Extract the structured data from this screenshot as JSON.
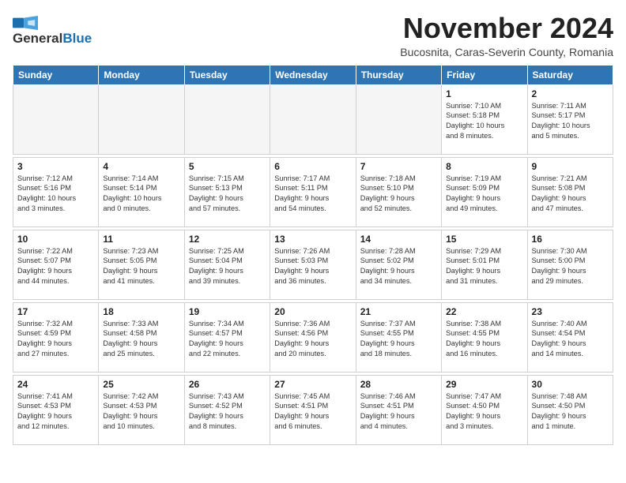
{
  "header": {
    "logo_line1": "General",
    "logo_line2": "Blue",
    "month_title": "November 2024",
    "subtitle": "Bucosnita, Caras-Severin County, Romania"
  },
  "weekdays": [
    "Sunday",
    "Monday",
    "Tuesday",
    "Wednesday",
    "Thursday",
    "Friday",
    "Saturday"
  ],
  "weeks": [
    [
      {
        "day": "",
        "info": ""
      },
      {
        "day": "",
        "info": ""
      },
      {
        "day": "",
        "info": ""
      },
      {
        "day": "",
        "info": ""
      },
      {
        "day": "",
        "info": ""
      },
      {
        "day": "1",
        "info": "Sunrise: 7:10 AM\nSunset: 5:18 PM\nDaylight: 10 hours\nand 8 minutes."
      },
      {
        "day": "2",
        "info": "Sunrise: 7:11 AM\nSunset: 5:17 PM\nDaylight: 10 hours\nand 5 minutes."
      }
    ],
    [
      {
        "day": "3",
        "info": "Sunrise: 7:12 AM\nSunset: 5:16 PM\nDaylight: 10 hours\nand 3 minutes."
      },
      {
        "day": "4",
        "info": "Sunrise: 7:14 AM\nSunset: 5:14 PM\nDaylight: 10 hours\nand 0 minutes."
      },
      {
        "day": "5",
        "info": "Sunrise: 7:15 AM\nSunset: 5:13 PM\nDaylight: 9 hours\nand 57 minutes."
      },
      {
        "day": "6",
        "info": "Sunrise: 7:17 AM\nSunset: 5:11 PM\nDaylight: 9 hours\nand 54 minutes."
      },
      {
        "day": "7",
        "info": "Sunrise: 7:18 AM\nSunset: 5:10 PM\nDaylight: 9 hours\nand 52 minutes."
      },
      {
        "day": "8",
        "info": "Sunrise: 7:19 AM\nSunset: 5:09 PM\nDaylight: 9 hours\nand 49 minutes."
      },
      {
        "day": "9",
        "info": "Sunrise: 7:21 AM\nSunset: 5:08 PM\nDaylight: 9 hours\nand 47 minutes."
      }
    ],
    [
      {
        "day": "10",
        "info": "Sunrise: 7:22 AM\nSunset: 5:07 PM\nDaylight: 9 hours\nand 44 minutes."
      },
      {
        "day": "11",
        "info": "Sunrise: 7:23 AM\nSunset: 5:05 PM\nDaylight: 9 hours\nand 41 minutes."
      },
      {
        "day": "12",
        "info": "Sunrise: 7:25 AM\nSunset: 5:04 PM\nDaylight: 9 hours\nand 39 minutes."
      },
      {
        "day": "13",
        "info": "Sunrise: 7:26 AM\nSunset: 5:03 PM\nDaylight: 9 hours\nand 36 minutes."
      },
      {
        "day": "14",
        "info": "Sunrise: 7:28 AM\nSunset: 5:02 PM\nDaylight: 9 hours\nand 34 minutes."
      },
      {
        "day": "15",
        "info": "Sunrise: 7:29 AM\nSunset: 5:01 PM\nDaylight: 9 hours\nand 31 minutes."
      },
      {
        "day": "16",
        "info": "Sunrise: 7:30 AM\nSunset: 5:00 PM\nDaylight: 9 hours\nand 29 minutes."
      }
    ],
    [
      {
        "day": "17",
        "info": "Sunrise: 7:32 AM\nSunset: 4:59 PM\nDaylight: 9 hours\nand 27 minutes."
      },
      {
        "day": "18",
        "info": "Sunrise: 7:33 AM\nSunset: 4:58 PM\nDaylight: 9 hours\nand 25 minutes."
      },
      {
        "day": "19",
        "info": "Sunrise: 7:34 AM\nSunset: 4:57 PM\nDaylight: 9 hours\nand 22 minutes."
      },
      {
        "day": "20",
        "info": "Sunrise: 7:36 AM\nSunset: 4:56 PM\nDaylight: 9 hours\nand 20 minutes."
      },
      {
        "day": "21",
        "info": "Sunrise: 7:37 AM\nSunset: 4:55 PM\nDaylight: 9 hours\nand 18 minutes."
      },
      {
        "day": "22",
        "info": "Sunrise: 7:38 AM\nSunset: 4:55 PM\nDaylight: 9 hours\nand 16 minutes."
      },
      {
        "day": "23",
        "info": "Sunrise: 7:40 AM\nSunset: 4:54 PM\nDaylight: 9 hours\nand 14 minutes."
      }
    ],
    [
      {
        "day": "24",
        "info": "Sunrise: 7:41 AM\nSunset: 4:53 PM\nDaylight: 9 hours\nand 12 minutes."
      },
      {
        "day": "25",
        "info": "Sunrise: 7:42 AM\nSunset: 4:53 PM\nDaylight: 9 hours\nand 10 minutes."
      },
      {
        "day": "26",
        "info": "Sunrise: 7:43 AM\nSunset: 4:52 PM\nDaylight: 9 hours\nand 8 minutes."
      },
      {
        "day": "27",
        "info": "Sunrise: 7:45 AM\nSunset: 4:51 PM\nDaylight: 9 hours\nand 6 minutes."
      },
      {
        "day": "28",
        "info": "Sunrise: 7:46 AM\nSunset: 4:51 PM\nDaylight: 9 hours\nand 4 minutes."
      },
      {
        "day": "29",
        "info": "Sunrise: 7:47 AM\nSunset: 4:50 PM\nDaylight: 9 hours\nand 3 minutes."
      },
      {
        "day": "30",
        "info": "Sunrise: 7:48 AM\nSunset: 4:50 PM\nDaylight: 9 hours\nand 1 minute."
      }
    ]
  ]
}
